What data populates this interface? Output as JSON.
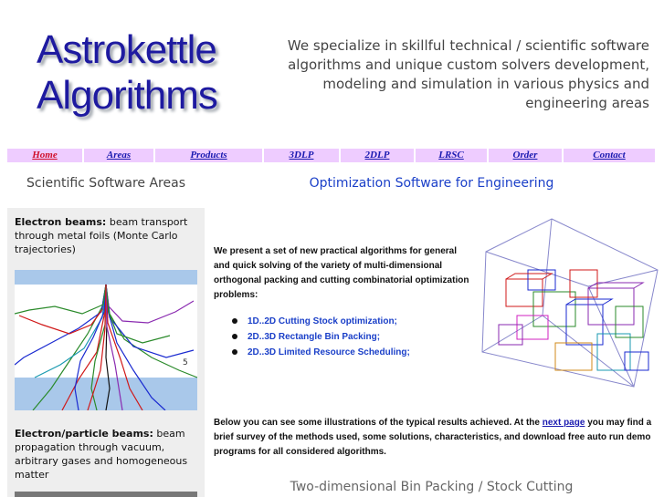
{
  "header": {
    "logo_line1": "Astrokettle",
    "logo_line2": "Algorithms",
    "tagline": "We specialize in skillful technical / scientific software algorithms and unique custom solvers development, modeling and simulation in various physics and engineering areas"
  },
  "nav": {
    "items": [
      {
        "label": "Home",
        "active": true
      },
      {
        "label": "Areas"
      },
      {
        "label": "Products"
      },
      {
        "label": "3DLP"
      },
      {
        "label": "2DLP"
      },
      {
        "label": "LRSC"
      },
      {
        "label": "Order"
      },
      {
        "label": "Contact"
      }
    ]
  },
  "sidebar": {
    "title": "Scientific Software Areas",
    "item1_heading": "Electron beams:",
    "item1_text": "beam transport through metal foils (Monte Carlo trajectories)",
    "item2_heading": "Electron/particle beams:",
    "item2_text": "beam propagation through vacuum, arbitrary gases and homogeneous matter"
  },
  "main": {
    "title": "Optimization Software for Engineering",
    "intro": "We present a set of new practical algorithms for general and quick solving of the variety of multi-dimensional orthogonal packing and cutting combinatorial optimization problems:",
    "bullets": [
      "1D..2D Cutting Stock optimization;",
      "2D..3D Rectangle Bin Packing;",
      "2D..3D Limited Resource Scheduling;"
    ],
    "para_before_link": "Below you can see some illustrations of the typical results achieved.  At the ",
    "para_link": "next page",
    "para_after_link": " you may find a brief survey of the methods used, some solutions, characteristics, and download free auto run demo programs for all considered algorithms.",
    "subtitle": "Two-dimensional Bin Packing / Stock Cutting"
  },
  "colors": {
    "nav_bg": "#eeccff",
    "logo": "#1e1aa0",
    "title_blue": "#1a3fc8",
    "sidebar_bg": "#eeeeee"
  }
}
